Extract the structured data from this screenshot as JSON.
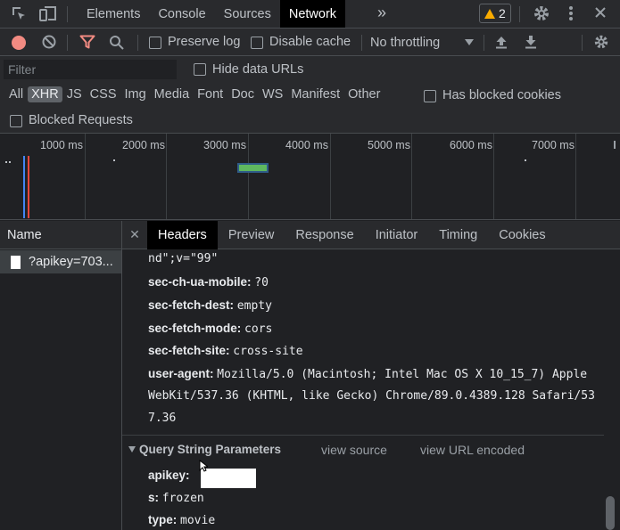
{
  "topbar": {
    "tabs": [
      "Elements",
      "Console",
      "Sources",
      "Network"
    ],
    "active_tab": "Network",
    "more_tabs_glyph": "»",
    "warning_count": "2"
  },
  "toolbar": {
    "preserve_log": "Preserve log",
    "disable_cache": "Disable cache",
    "throttling": "No throttling"
  },
  "filter": {
    "placeholder": "Filter",
    "hide_data_urls": "Hide data URLs"
  },
  "types": {
    "items": [
      "All",
      "XHR",
      "JS",
      "CSS",
      "Img",
      "Media",
      "Font",
      "Doc",
      "WS",
      "Manifest",
      "Other"
    ],
    "active": "XHR",
    "has_blocked_cookies": "Has blocked cookies",
    "blocked_requests": "Blocked Requests"
  },
  "overview": {
    "ticks": [
      "1000 ms",
      "2000 ms",
      "3000 ms",
      "4000 ms",
      "5000 ms",
      "6000 ms",
      "7000 ms"
    ]
  },
  "namepane": {
    "header": "Name",
    "request": "?apikey=703..."
  },
  "detail": {
    "tabs": [
      "Headers",
      "Preview",
      "Response",
      "Initiator",
      "Timing",
      "Cookies"
    ],
    "active_tab": "Headers",
    "partial_line": "nd\";v=\"99\"",
    "headers": [
      {
        "key": "sec-ch-ua-mobile:",
        "value": "?0"
      },
      {
        "key": "sec-fetch-dest:",
        "value": "empty"
      },
      {
        "key": "sec-fetch-mode:",
        "value": "cors"
      },
      {
        "key": "sec-fetch-site:",
        "value": "cross-site"
      },
      {
        "key": "user-agent:",
        "value": "Mozilla/5.0 (Macintosh; Intel Mac OS X 10_15_7) Apple"
      }
    ],
    "ua_cont1": "WebKit/537.36 (KHTML, like Gecko) Chrome/89.0.4389.128 Safari/53",
    "ua_cont2": "7.36",
    "qsp": {
      "title": "Query String Parameters",
      "view_source": "view source",
      "view_url_encoded": "view URL encoded",
      "params": [
        {
          "key": "apikey:",
          "value": ""
        },
        {
          "key": "s:",
          "value": "frozen"
        },
        {
          "key": "type:",
          "value": "movie"
        }
      ]
    }
  },
  "colors": {
    "accent_red": "#f28b82",
    "warning": "#f9ab00",
    "timeline_bar": "#5fb85f"
  }
}
